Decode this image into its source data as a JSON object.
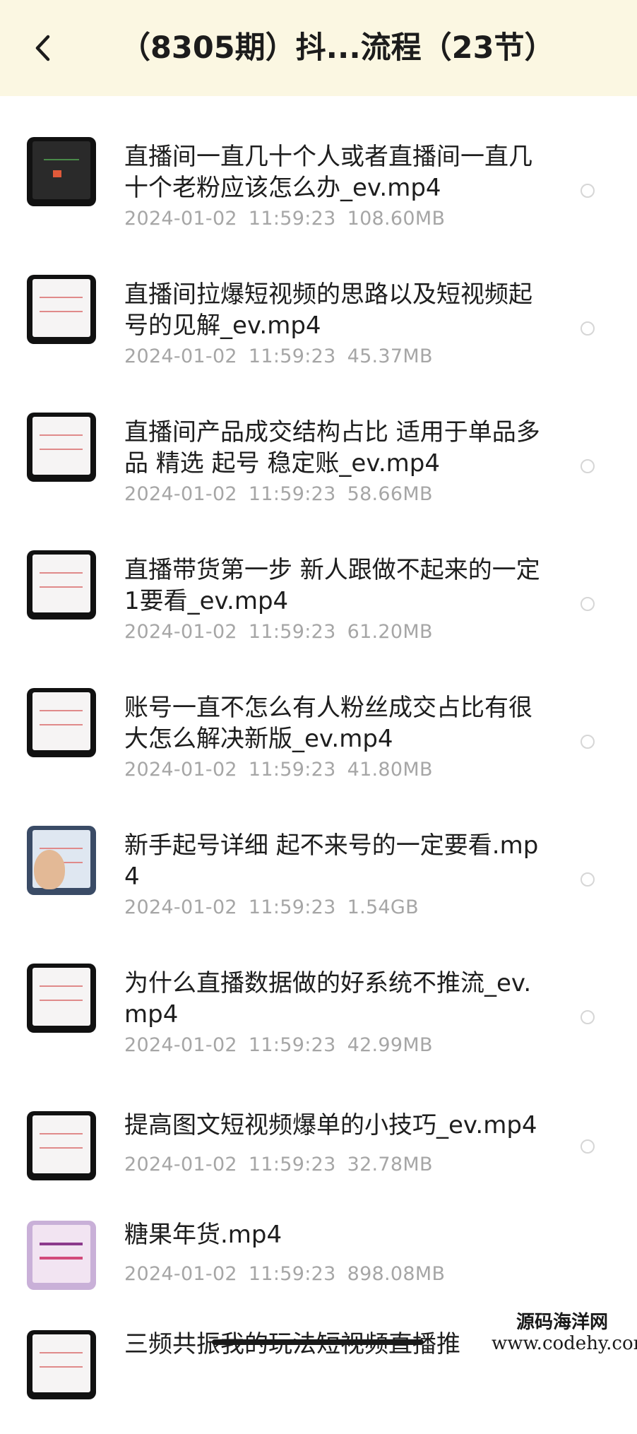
{
  "header": {
    "title": "（8305期）抖...流程（23节）",
    "back_icon": "chevron-left-icon"
  },
  "files": [
    {
      "name": "直播间一直几十个人或者直播间一直几十个老粉应该怎么办_ev.mp4",
      "date": "2024-01-02",
      "time": "11:59:23",
      "size": "108.60MB",
      "thumb": "dark"
    },
    {
      "name": "直播间拉爆短视频的思路以及短视频起号的见解_ev.mp4",
      "date": "2024-01-02",
      "time": "11:59:23",
      "size": "45.37MB",
      "thumb": "doc"
    },
    {
      "name": "直播间产品成交结构占比 适用于单品多品 精选 起号 稳定账_ev.mp4",
      "date": "2024-01-02",
      "time": "11:59:23",
      "size": "58.66MB",
      "thumb": "doc"
    },
    {
      "name": "直播带货第一步 新人跟做不起来的一定1要看_ev.mp4",
      "date": "2024-01-02",
      "time": "11:59:23",
      "size": "61.20MB",
      "thumb": "doc"
    },
    {
      "name": "账号一直不怎么有人粉丝成交占比有很大怎么解决新版_ev.mp4",
      "date": "2024-01-02",
      "time": "11:59:23",
      "size": "41.80MB",
      "thumb": "doc"
    },
    {
      "name": "新手起号详细 起不来号的一定要看.mp4",
      "date": "2024-01-02",
      "time": "11:59:23",
      "size": "1.54GB",
      "thumb": "person"
    },
    {
      "name": "为什么直播数据做的好系统不推流_ev.mp4",
      "date": "2024-01-02",
      "time": "11:59:23",
      "size": "42.99MB",
      "thumb": "doc"
    },
    {
      "name": "提高图文短视频爆单的小技巧_ev.mp4",
      "date": "2024-01-02",
      "time": "11:59:23",
      "size": "32.78MB",
      "thumb": "doc"
    },
    {
      "name": "糖果年货.mp4",
      "date": "2024-01-02",
      "time": "11:59:23",
      "size": "898.08MB",
      "thumb": "candy"
    },
    {
      "name": "三频共振我的玩法短视频直播推",
      "date": "",
      "time": "",
      "size": "",
      "thumb": "doc"
    }
  ],
  "watermark": {
    "title": "源码海洋网",
    "url": "www.codehy.com"
  }
}
